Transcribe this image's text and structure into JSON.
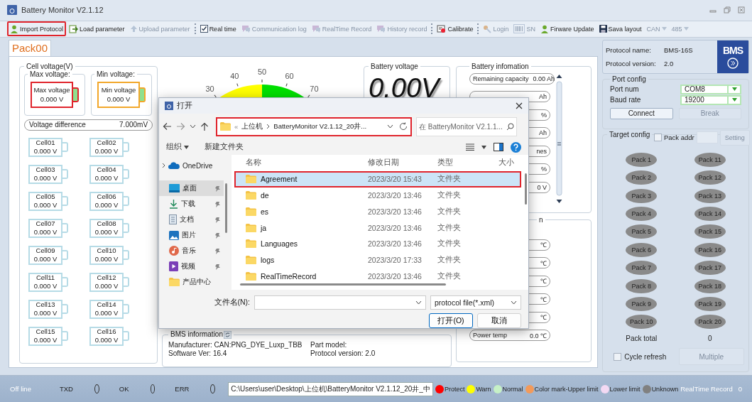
{
  "window": {
    "title": "Battery Monitor V2.1.12"
  },
  "toolbar": [
    {
      "kind": "button",
      "label": "Import Protocol",
      "disabled": false,
      "outlined": true
    },
    {
      "kind": "button",
      "label": "Load parameter",
      "disabled": false,
      "outlined": false
    },
    {
      "kind": "button",
      "label": "Upload parameter",
      "disabled": true,
      "outlined": false
    },
    {
      "kind": "separator"
    },
    {
      "kind": "button",
      "label": "Real time",
      "disabled": false,
      "outlined": false
    },
    {
      "kind": "button",
      "label": "Communication log",
      "disabled": true,
      "outlined": false
    },
    {
      "kind": "button",
      "label": "RealTime Record",
      "disabled": true,
      "outlined": false
    },
    {
      "kind": "button",
      "label": "History record",
      "disabled": true,
      "outlined": false
    },
    {
      "kind": "separator"
    },
    {
      "kind": "button",
      "label": "Calibrate",
      "disabled": false,
      "outlined": false
    },
    {
      "kind": "separator"
    },
    {
      "kind": "button",
      "label": "Login",
      "disabled": true,
      "outlined": false
    },
    {
      "kind": "button",
      "label": "SN",
      "disabled": true,
      "outlined": false
    },
    {
      "kind": "button",
      "label": "Firware Update",
      "disabled": false,
      "outlined": false
    },
    {
      "kind": "button",
      "label": "Sava layout",
      "disabled": false,
      "outlined": false
    },
    {
      "kind": "dropdown",
      "label": "CAN",
      "disabled": true,
      "outlined": false
    },
    {
      "kind": "dropdown",
      "label": "485",
      "disabled": true,
      "outlined": false
    }
  ],
  "tabs": [
    {
      "label": "Pack00",
      "selected": true
    }
  ],
  "cell_voltage": {
    "title": "Cell voltage(V)",
    "max": {
      "group_title": "Max voltage:",
      "label": "Max voltage",
      "value": "0.000 V",
      "color": "#e0242c"
    },
    "min": {
      "group_title": "Min voltage:",
      "label": "Min voltage",
      "value": "0.000 V",
      "color": "#f2a72a"
    },
    "difference": {
      "label": "Voltage difference",
      "value": "7.000mV"
    },
    "cells": [
      {
        "name": "Cell01",
        "value": "0.000 V"
      },
      {
        "name": "Cell02",
        "value": "0.000 V"
      },
      {
        "name": "Cell03",
        "value": "0.000 V"
      },
      {
        "name": "Cell04",
        "value": "0.000 V"
      },
      {
        "name": "Cell05",
        "value": "0.000 V"
      },
      {
        "name": "Cell06",
        "value": "0.000 V"
      },
      {
        "name": "Cell07",
        "value": "0.000 V"
      },
      {
        "name": "Cell08",
        "value": "0.000 V"
      },
      {
        "name": "Cell09",
        "value": "0.000 V"
      },
      {
        "name": "Cell10",
        "value": "0.000 V"
      },
      {
        "name": "Cell11",
        "value": "0.000 V"
      },
      {
        "name": "Cell12",
        "value": "0.000 V"
      },
      {
        "name": "Cell13",
        "value": "0.000 V"
      },
      {
        "name": "Cell14",
        "value": "0.000 V"
      },
      {
        "name": "Cell15",
        "value": "0.000 V"
      },
      {
        "name": "Cell16",
        "value": "0.000 V"
      }
    ]
  },
  "gauge": {
    "labels": [
      "30",
      "40",
      "50",
      "60",
      "70"
    ]
  },
  "battery_voltage": {
    "title": "Battery voltage",
    "value": "0.00V"
  },
  "battery_info": {
    "title": "Battery infomation",
    "items": [
      {
        "label": "Remaining capacity",
        "value": "0.00 Ah"
      },
      {
        "value": "Ah"
      },
      {
        "value": "%"
      },
      {
        "value": "Ah"
      },
      {
        "value": "nes"
      },
      {
        "value": "%"
      },
      {
        "value": "0 V"
      }
    ]
  },
  "temperature": {
    "title": "n",
    "items": [
      {
        "value": "℃"
      },
      {
        "value": "℃"
      },
      {
        "value": "℃"
      },
      {
        "value": "℃"
      },
      {
        "value": "℃"
      },
      {
        "label": "Power temp",
        "value": "0.0 ℃"
      }
    ]
  },
  "bms_info": {
    "title": "BMS information",
    "fields": [
      {
        "label": "Manufacturer:",
        "value": "CAN:PNG_DYE_Luxp_TBB"
      },
      {
        "label": "Part model:"
      },
      {
        "label": "Software Ver:",
        "value": "16.4"
      },
      {
        "label": "Protocol version:",
        "value": "2.0"
      }
    ]
  },
  "protocol": {
    "name_label": "Protocol name:",
    "name": "BMS-16S",
    "version_label": "Protocol version:",
    "version": "2.0",
    "logo": "BMS"
  },
  "port_config": {
    "title": "Port config",
    "port_label": "Port num",
    "port": "COM8",
    "baud_label": "Baud rate",
    "baud": "19200",
    "buttons": [
      {
        "label": "Connect",
        "disabled": false
      },
      {
        "label": "Break",
        "disabled": true
      }
    ]
  },
  "target_config": {
    "title": "Target config",
    "pack_addr": {
      "label": "Pack addr",
      "checked": false
    },
    "setting": {
      "label": "Setting",
      "disabled": true
    },
    "packs": [
      "Pack 1",
      "Pack 11",
      "Pack 2",
      "Pack 12",
      "Pack 3",
      "Pack 13",
      "Pack 4",
      "Pack 14",
      "Pack 5",
      "Pack 15",
      "Pack 6",
      "Pack 16",
      "Pack 7",
      "Pack 17",
      "Pack 8",
      "Pack 18",
      "Pack 9",
      "Pack 19",
      "Pack 10",
      "Pack 20"
    ],
    "total_label": "Pack total",
    "total": "0",
    "cycle_refresh": {
      "label": "Cycle refresh",
      "checked": false
    },
    "multiple": {
      "label": "Multiple",
      "disabled": true
    }
  },
  "status_bar": {
    "connection": "Off line",
    "indicators": [
      {
        "label": "TXD",
        "on": false
      },
      {
        "label": "OK",
        "on": false
      },
      {
        "label": "ERR",
        "on": false
      }
    ],
    "path": "C:\\Users\\user\\Desktop\\上位机\\BatteryMonitor V2.1.12_20井_中",
    "legend": [
      {
        "label": "Protect",
        "color": "#ff0000"
      },
      {
        "label": "Warn",
        "color": "#ffff00"
      },
      {
        "label": "Normal",
        "color": "#c6f0c6"
      },
      {
        "label": "Color mark-Upper limit",
        "color": "#f39a5a"
      },
      {
        "label": "Lower limit",
        "color": "#f3d9f3"
      },
      {
        "label": "Unknown",
        "color": "#808080"
      }
    ],
    "record_label": "RealTime Record",
    "record_count": "0"
  },
  "dialog": {
    "title": "打开",
    "address": {
      "prefix": "«",
      "segments": [
        "上位机",
        "BatteryMonitor V2.1.12_20井..."
      ],
      "outlined": true
    },
    "search": {
      "placeholder": "在 BatteryMonitor V2.1.1..."
    },
    "commands": [
      {
        "label": "组织",
        "kind": "menu"
      },
      {
        "label": "新建文件夹",
        "kind": "button"
      }
    ],
    "nav": [
      {
        "label": "OneDrive",
        "kind": "cloud",
        "selected": false,
        "pinned": false
      },
      {
        "label": "桌面",
        "kind": "desktop",
        "selected": true,
        "pinned": true
      },
      {
        "label": "下载",
        "kind": "download",
        "selected": false,
        "pinned": true
      },
      {
        "label": "文档",
        "kind": "documents",
        "selected": false,
        "pinned": true
      },
      {
        "label": "图片",
        "kind": "pictures",
        "selected": false,
        "pinned": true
      },
      {
        "label": "音乐",
        "kind": "music",
        "selected": false,
        "pinned": true
      },
      {
        "label": "视频",
        "kind": "videos",
        "selected": false,
        "pinned": true
      },
      {
        "label": "产品中心",
        "kind": "folder",
        "selected": false,
        "pinned": false
      }
    ],
    "columns": [
      "名称",
      "修改日期",
      "类型",
      "大小"
    ],
    "rows": [
      {
        "name": "Agreement",
        "modified": "2023/3/20 15:43",
        "type": "文件夹",
        "selected": true,
        "outlined": true
      },
      {
        "name": "de",
        "modified": "2023/3/20 13:46",
        "type": "文件夹",
        "selected": false,
        "outlined": false
      },
      {
        "name": "es",
        "modified": "2023/3/20 13:46",
        "type": "文件夹",
        "selected": false,
        "outlined": false
      },
      {
        "name": "ja",
        "modified": "2023/3/20 13:46",
        "type": "文件夹",
        "selected": false,
        "outlined": false
      },
      {
        "name": "Languages",
        "modified": "2023/3/20 13:46",
        "type": "文件夹",
        "selected": false,
        "outlined": false
      },
      {
        "name": "logs",
        "modified": "2023/3/20 17:33",
        "type": "文件夹",
        "selected": false,
        "outlined": false
      },
      {
        "name": "RealTimeRecord",
        "modified": "2023/3/20 13:46",
        "type": "文件夹",
        "selected": false,
        "outlined": false
      }
    ],
    "filename_label": "文件名(N):",
    "filter": "protocol file(*.xml)",
    "buttons": [
      {
        "label": "打开(O)",
        "default": true
      },
      {
        "label": "取消",
        "default": false
      }
    ]
  }
}
